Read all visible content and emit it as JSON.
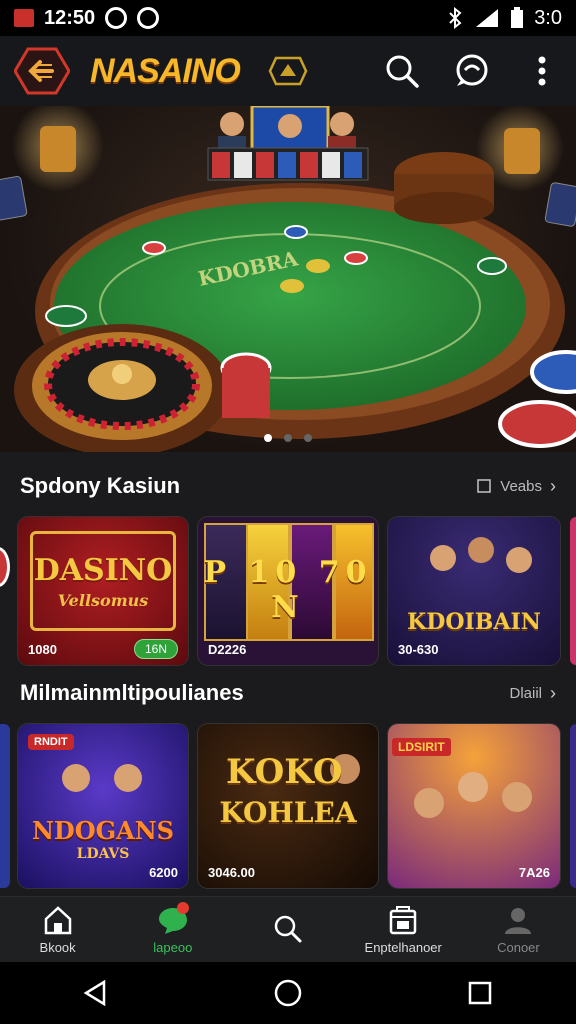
{
  "status_bar": {
    "time": "12:50",
    "right_text": "3:0"
  },
  "header": {
    "brand": "NASAINO"
  },
  "hero": {
    "slide_count": 3,
    "active_slide": 1
  },
  "section1": {
    "title": "Spdony Kasiun",
    "link_label": "Veabs",
    "cards": [
      {
        "title_line1": "DASINO",
        "title_line2": "Vellsomus",
        "footer": "1080",
        "pill": "16N"
      },
      {
        "title": "P 10 70 N",
        "footer": "D2226"
      },
      {
        "title": "KDOIBAIN",
        "footer": "30-630"
      }
    ]
  },
  "section2": {
    "title": "Milmainmltipoulianes",
    "link_label": "Dlaiil",
    "cards": [
      {
        "badge": "RNDIT",
        "title_line1": "NDOGANS",
        "title_line2": "LDAVS",
        "footer": "6200"
      },
      {
        "title_line1": "KOKO",
        "title_line2": "KOHLEA",
        "footer": "3046.00"
      },
      {
        "badge": "LDSIRIT",
        "footer": "7A26"
      }
    ]
  },
  "bottom_nav": [
    {
      "label": "Bkook",
      "icon": "home-icon"
    },
    {
      "label": "lapeoo",
      "icon": "chat-icon"
    },
    {
      "label": "",
      "icon": "search-icon"
    },
    {
      "label": "Enptelhanoer",
      "icon": "store-icon"
    },
    {
      "label": "Conoer",
      "icon": "profile-icon"
    }
  ],
  "colors": {
    "brand": "#f7b72a",
    "accent_green": "#3ac05a",
    "felt": "#2e8b3a"
  }
}
